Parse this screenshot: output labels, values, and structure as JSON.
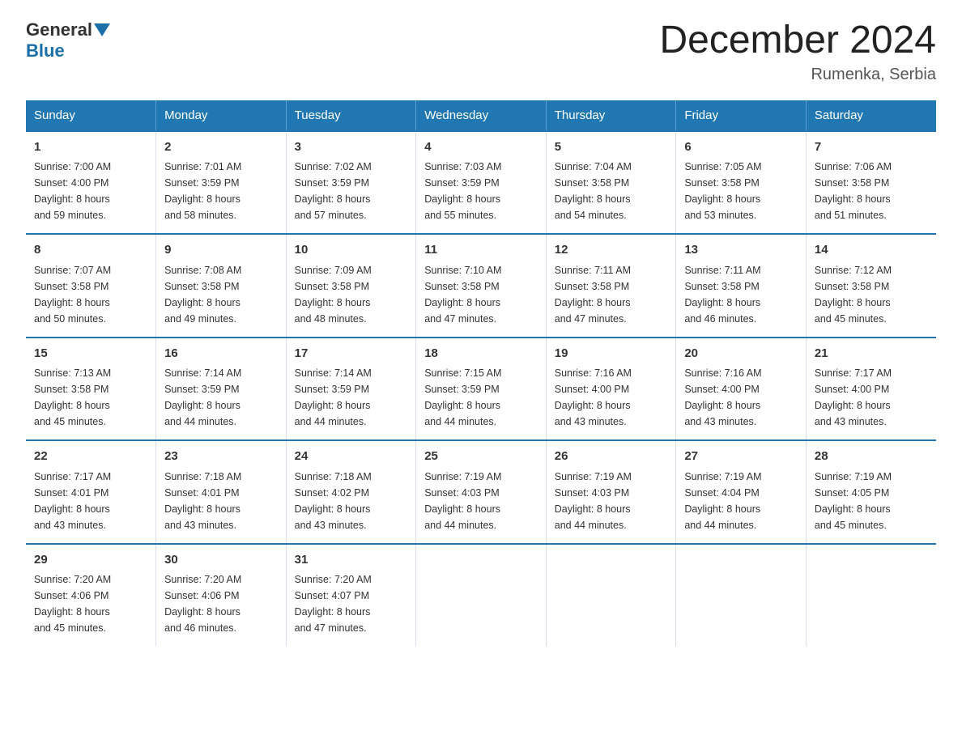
{
  "logo": {
    "general": "General",
    "blue": "Blue"
  },
  "header": {
    "title": "December 2024",
    "subtitle": "Rumenka, Serbia"
  },
  "days_of_week": [
    "Sunday",
    "Monday",
    "Tuesday",
    "Wednesday",
    "Thursday",
    "Friday",
    "Saturday"
  ],
  "weeks": [
    [
      {
        "day": "1",
        "sunrise": "7:00 AM",
        "sunset": "4:00 PM",
        "daylight": "8 hours and 59 minutes."
      },
      {
        "day": "2",
        "sunrise": "7:01 AM",
        "sunset": "3:59 PM",
        "daylight": "8 hours and 58 minutes."
      },
      {
        "day": "3",
        "sunrise": "7:02 AM",
        "sunset": "3:59 PM",
        "daylight": "8 hours and 57 minutes."
      },
      {
        "day": "4",
        "sunrise": "7:03 AM",
        "sunset": "3:59 PM",
        "daylight": "8 hours and 55 minutes."
      },
      {
        "day": "5",
        "sunrise": "7:04 AM",
        "sunset": "3:58 PM",
        "daylight": "8 hours and 54 minutes."
      },
      {
        "day": "6",
        "sunrise": "7:05 AM",
        "sunset": "3:58 PM",
        "daylight": "8 hours and 53 minutes."
      },
      {
        "day": "7",
        "sunrise": "7:06 AM",
        "sunset": "3:58 PM",
        "daylight": "8 hours and 51 minutes."
      }
    ],
    [
      {
        "day": "8",
        "sunrise": "7:07 AM",
        "sunset": "3:58 PM",
        "daylight": "8 hours and 50 minutes."
      },
      {
        "day": "9",
        "sunrise": "7:08 AM",
        "sunset": "3:58 PM",
        "daylight": "8 hours and 49 minutes."
      },
      {
        "day": "10",
        "sunrise": "7:09 AM",
        "sunset": "3:58 PM",
        "daylight": "8 hours and 48 minutes."
      },
      {
        "day": "11",
        "sunrise": "7:10 AM",
        "sunset": "3:58 PM",
        "daylight": "8 hours and 47 minutes."
      },
      {
        "day": "12",
        "sunrise": "7:11 AM",
        "sunset": "3:58 PM",
        "daylight": "8 hours and 47 minutes."
      },
      {
        "day": "13",
        "sunrise": "7:11 AM",
        "sunset": "3:58 PM",
        "daylight": "8 hours and 46 minutes."
      },
      {
        "day": "14",
        "sunrise": "7:12 AM",
        "sunset": "3:58 PM",
        "daylight": "8 hours and 45 minutes."
      }
    ],
    [
      {
        "day": "15",
        "sunrise": "7:13 AM",
        "sunset": "3:58 PM",
        "daylight": "8 hours and 45 minutes."
      },
      {
        "day": "16",
        "sunrise": "7:14 AM",
        "sunset": "3:59 PM",
        "daylight": "8 hours and 44 minutes."
      },
      {
        "day": "17",
        "sunrise": "7:14 AM",
        "sunset": "3:59 PM",
        "daylight": "8 hours and 44 minutes."
      },
      {
        "day": "18",
        "sunrise": "7:15 AM",
        "sunset": "3:59 PM",
        "daylight": "8 hours and 44 minutes."
      },
      {
        "day": "19",
        "sunrise": "7:16 AM",
        "sunset": "4:00 PM",
        "daylight": "8 hours and 43 minutes."
      },
      {
        "day": "20",
        "sunrise": "7:16 AM",
        "sunset": "4:00 PM",
        "daylight": "8 hours and 43 minutes."
      },
      {
        "day": "21",
        "sunrise": "7:17 AM",
        "sunset": "4:00 PM",
        "daylight": "8 hours and 43 minutes."
      }
    ],
    [
      {
        "day": "22",
        "sunrise": "7:17 AM",
        "sunset": "4:01 PM",
        "daylight": "8 hours and 43 minutes."
      },
      {
        "day": "23",
        "sunrise": "7:18 AM",
        "sunset": "4:01 PM",
        "daylight": "8 hours and 43 minutes."
      },
      {
        "day": "24",
        "sunrise": "7:18 AM",
        "sunset": "4:02 PM",
        "daylight": "8 hours and 43 minutes."
      },
      {
        "day": "25",
        "sunrise": "7:19 AM",
        "sunset": "4:03 PM",
        "daylight": "8 hours and 44 minutes."
      },
      {
        "day": "26",
        "sunrise": "7:19 AM",
        "sunset": "4:03 PM",
        "daylight": "8 hours and 44 minutes."
      },
      {
        "day": "27",
        "sunrise": "7:19 AM",
        "sunset": "4:04 PM",
        "daylight": "8 hours and 44 minutes."
      },
      {
        "day": "28",
        "sunrise": "7:19 AM",
        "sunset": "4:05 PM",
        "daylight": "8 hours and 45 minutes."
      }
    ],
    [
      {
        "day": "29",
        "sunrise": "7:20 AM",
        "sunset": "4:06 PM",
        "daylight": "8 hours and 45 minutes."
      },
      {
        "day": "30",
        "sunrise": "7:20 AM",
        "sunset": "4:06 PM",
        "daylight": "8 hours and 46 minutes."
      },
      {
        "day": "31",
        "sunrise": "7:20 AM",
        "sunset": "4:07 PM",
        "daylight": "8 hours and 47 minutes."
      },
      null,
      null,
      null,
      null
    ]
  ],
  "labels": {
    "sunrise": "Sunrise:",
    "sunset": "Sunset:",
    "daylight": "Daylight:"
  }
}
